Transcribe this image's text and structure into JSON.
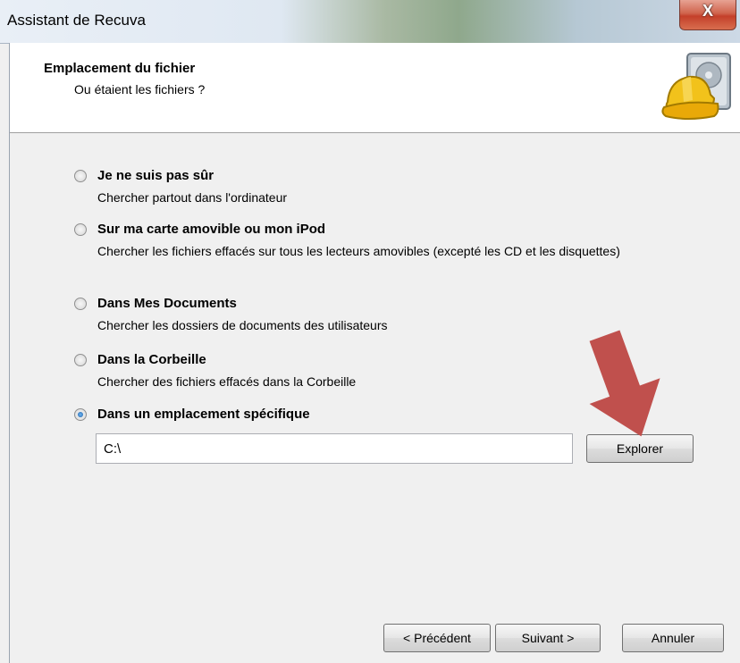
{
  "window": {
    "title": "Assistant de Recuva",
    "close_label": "X"
  },
  "header": {
    "title": "Emplacement du fichier",
    "subtitle": "Ou étaient les fichiers ?"
  },
  "options": [
    {
      "label": "Je ne suis pas sûr",
      "description": "Chercher partout dans l'ordinateur",
      "selected": false
    },
    {
      "label": "Sur ma carte amovible ou mon iPod",
      "description": "Chercher les fichiers effacés sur tous les lecteurs amovibles (excepté les CD et les disquettes)",
      "selected": false
    },
    {
      "label": "Dans Mes Documents",
      "description": "Chercher les dossiers de documents des utilisateurs",
      "selected": false
    },
    {
      "label": "Dans la Corbeille",
      "description": "Chercher des fichiers effacés dans la Corbeille",
      "selected": false
    },
    {
      "label": "Dans un emplacement spécifique",
      "description": "",
      "selected": true
    }
  ],
  "location": {
    "path_value": "C:\\",
    "browse_label": "Explorer"
  },
  "footer": {
    "back_label": "< Précédent",
    "next_label": "Suivant >",
    "cancel_label": "Annuler"
  },
  "colors": {
    "annotation_arrow": "#c0504d",
    "selected_radio": "#1c5fa8"
  }
}
